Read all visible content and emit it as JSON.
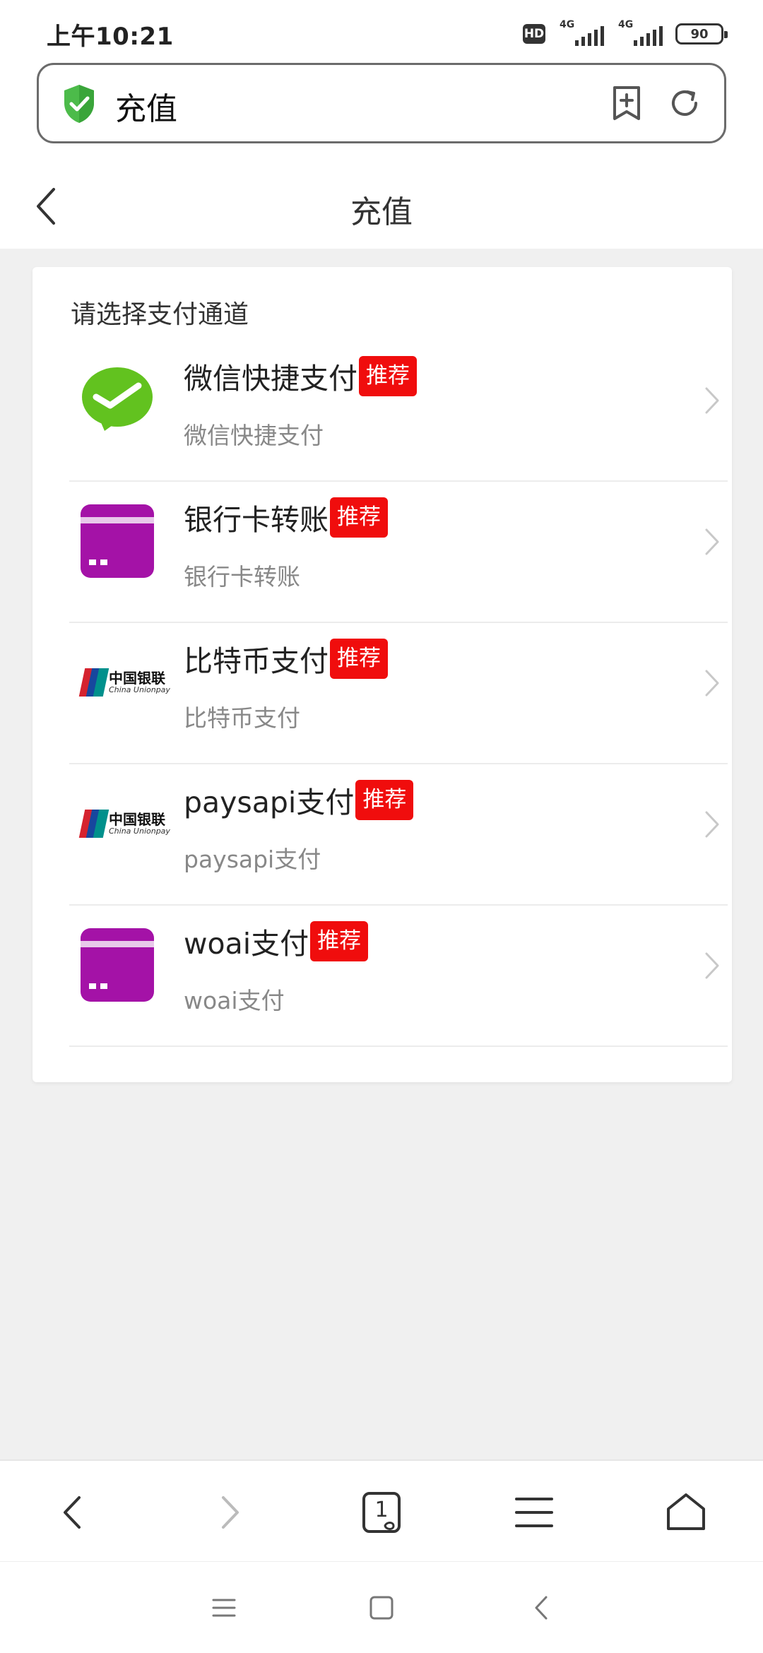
{
  "status_bar": {
    "time": "上午10:21",
    "hd": "HD",
    "network_1": "4G",
    "network_2": "4G",
    "battery": "90"
  },
  "url_bar": {
    "title": "充值",
    "shield_icon": "shield-check-icon",
    "bookmark_icon": "bookmark-add-icon",
    "refresh_icon": "refresh-icon"
  },
  "header": {
    "title": "充值",
    "back_icon": "chevron-left-icon"
  },
  "card": {
    "heading": "请选择支付通道",
    "channels": [
      {
        "name": "微信快捷支付",
        "badge": "推荐",
        "subtitle": "微信快捷支付",
        "icon": "wechat-pay-icon"
      },
      {
        "name": "银行卡转账",
        "badge": "推荐",
        "subtitle": "银行卡转账",
        "icon": "bank-card-icon"
      },
      {
        "name": "比特币支付",
        "badge": "推荐",
        "subtitle": "比特币支付",
        "icon": "unionpay-icon"
      },
      {
        "name": "paysapi支付",
        "badge": "推荐",
        "subtitle": "paysapi支付",
        "icon": "unionpay-icon"
      },
      {
        "name": "woai支付",
        "badge": "推荐",
        "subtitle": "woai支付",
        "icon": "bank-card-icon"
      }
    ],
    "unionpay_cn": "中国银联",
    "unionpay_en": "China Unionpay"
  },
  "toolbar": {
    "tab_count": "1",
    "icons": [
      "back-icon",
      "forward-icon",
      "tabs-icon",
      "menu-icon",
      "home-icon"
    ]
  },
  "system_nav": {
    "icons": [
      "recent-apps-icon",
      "home-icon",
      "back-icon"
    ]
  },
  "colors": {
    "badge": "#f00d0d",
    "wechat_green": "#62c21f",
    "card_purple": "#a412a7",
    "shield_green": "#4cbb4a"
  }
}
